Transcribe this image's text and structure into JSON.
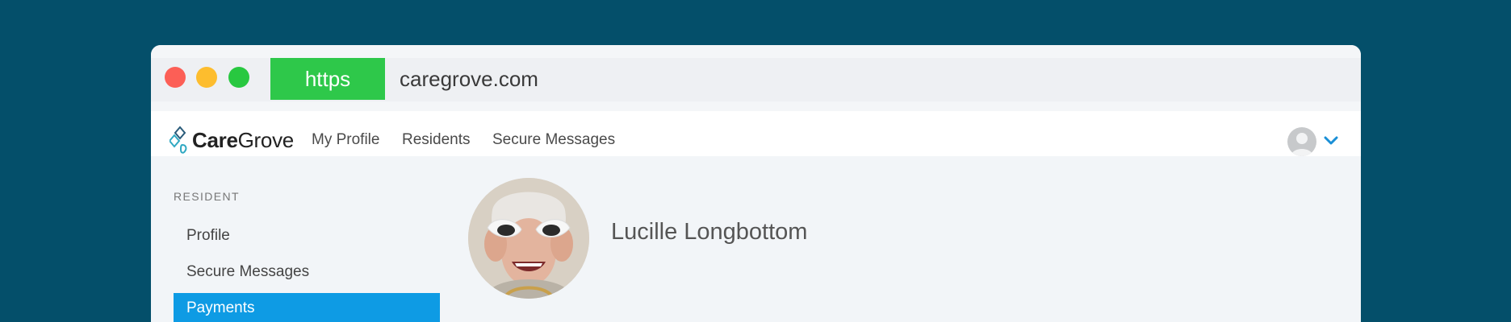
{
  "browser": {
    "protocol_badge": "https",
    "url": "caregrove.com"
  },
  "nav": {
    "logo": {
      "part1": "Care",
      "part2": "Grove"
    },
    "links": [
      "My Profile",
      "Residents",
      "Secure Messages"
    ]
  },
  "sidebar": {
    "section_label": "RESIDENT",
    "items": [
      {
        "label": "Profile",
        "active": false
      },
      {
        "label": "Secure Messages",
        "active": false
      },
      {
        "label": "Payments",
        "active": true
      }
    ]
  },
  "resident": {
    "name": "Lucille Longbottom"
  },
  "colors": {
    "background": "#044f6a",
    "https_badge": "#2ec84a",
    "accent": "#0e9be4"
  }
}
